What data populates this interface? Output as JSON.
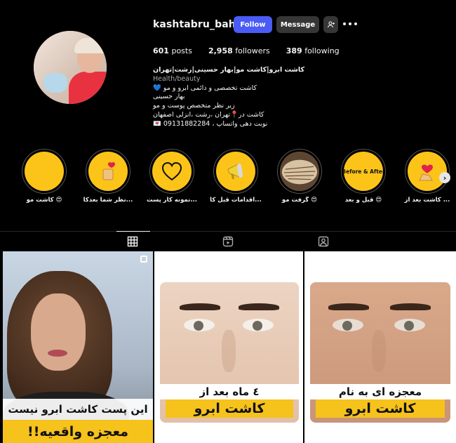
{
  "profile": {
    "username": "kashtabru_bahar",
    "follow_label": "Follow",
    "message_label": "Message",
    "stats": {
      "posts_count": "601",
      "posts_label": "posts",
      "followers_count": "2,958",
      "followers_label": "followers",
      "following_count": "389",
      "following_label": "following"
    },
    "bio": {
      "name": "کاشت ابرو|کاشت مو|بهار حسینی|رشت|تهران",
      "category": "Health/beauty",
      "lines": [
        "💙 کاشت تخصصی و دائمی ابرو و مو",
        "بهار حسینی",
        "زیر نظر متخصص پوست و مو",
        "کاشت در📍تهران ،رشت ،انزلی اصفهان",
        "💌 نوبت دهی واتساپ ، 09131882284"
      ]
    }
  },
  "highlights": [
    {
      "label": "کاشت مو 😍"
    },
    {
      "label": "نظر شما بعدکا..."
    },
    {
      "label": "نمونه کار پست..."
    },
    {
      "label": "اقدامات قبل کا..."
    },
    {
      "label": "گرفت مو 😍"
    },
    {
      "label": "قبل و بعد 😍",
      "cover_text": "Before & After"
    },
    {
      "label": "کاشت بعد از ..."
    }
  ],
  "tabs": [
    "posts",
    "reels",
    "tagged"
  ],
  "active_tab": "posts",
  "posts": [
    {
      "line1": "این پست کاشت ابرو نیست",
      "line2": "معجزه واقعیه!!"
    },
    {
      "line1": "٤ ماه بعد از",
      "line2": "کاشت ابرو"
    },
    {
      "line1": "معجزه ای به نام",
      "line2": "کاشت ابرو"
    }
  ],
  "colors": {
    "background": "#000000",
    "follow_button": "#4a5cf5",
    "secondary_button": "#363636",
    "highlight_fill": "#fcc419",
    "banner_yellow": "#f6c21c"
  }
}
